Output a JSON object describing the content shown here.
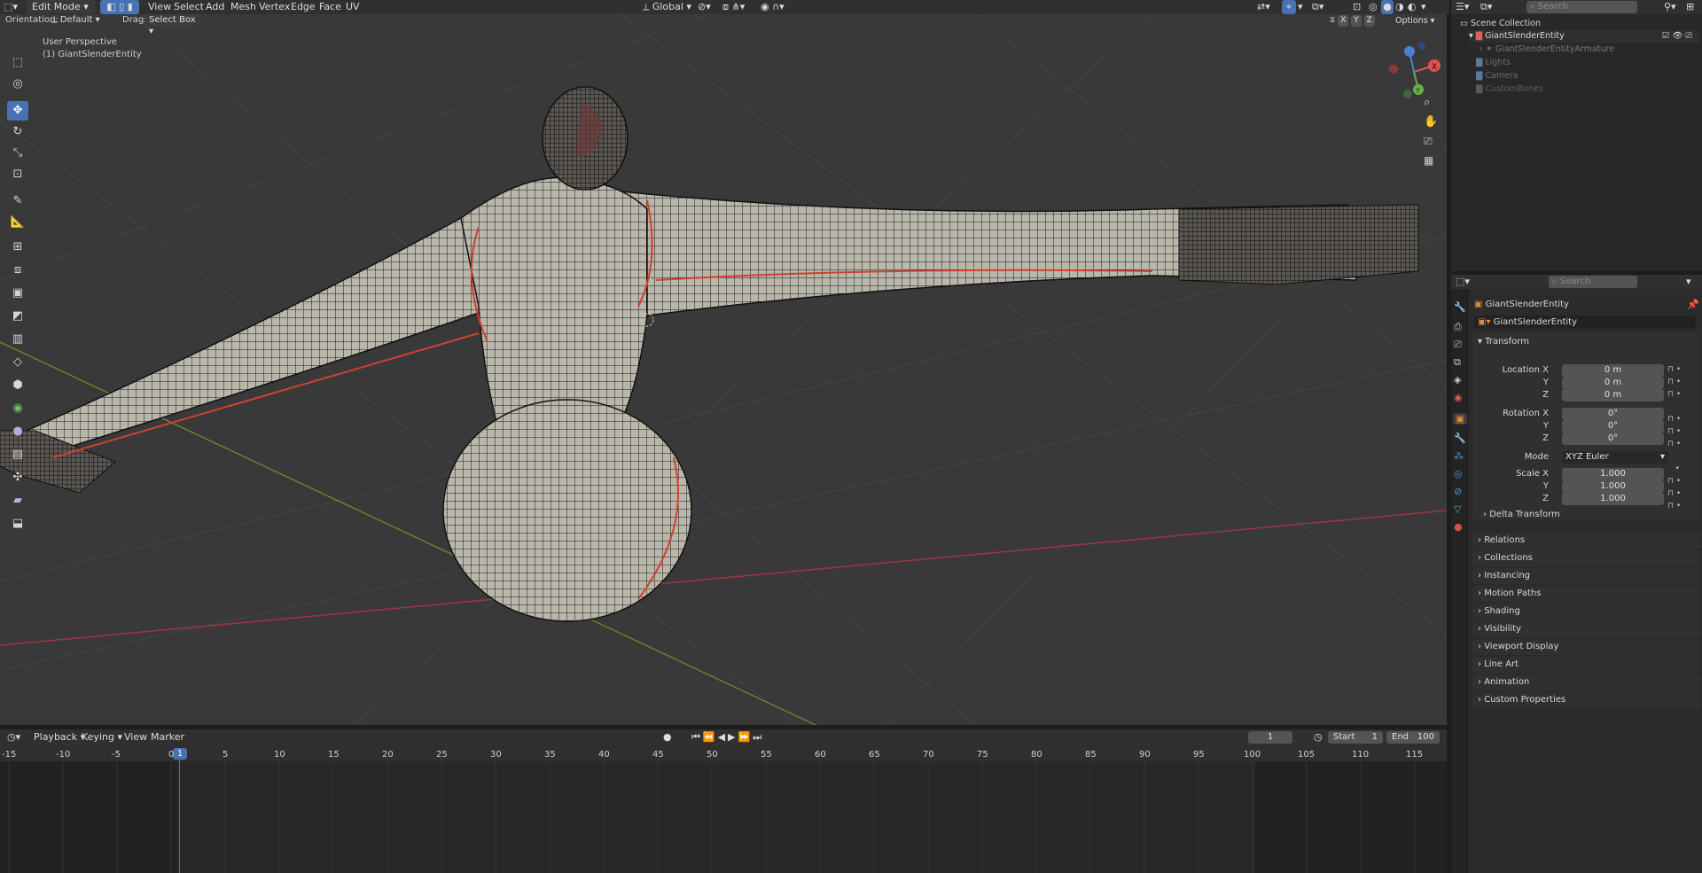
{
  "header": {
    "mode": "Edit Mode",
    "menus": [
      "View",
      "Select",
      "Add",
      "Mesh",
      "Vertex",
      "Edge",
      "Face",
      "UV"
    ],
    "transform_orientation": "Global",
    "search_placeholder": "Search"
  },
  "toolbar_header": {
    "orientation_label": "Orientation:",
    "orientation_value": "Default",
    "drag_label": "Drag:",
    "drag_value": "Select Box",
    "axes": [
      "X",
      "Y",
      "Z"
    ],
    "options": "Options"
  },
  "viewport": {
    "perspective": "User Perspective",
    "object": "(1) GiantSlenderEntity"
  },
  "outliner": {
    "root": "Scene Collection",
    "items": [
      {
        "label": "GiantSlenderEntity",
        "icon": "collection-icon",
        "color": "#e06060"
      },
      {
        "label": "GiantSlenderEntityArmature",
        "icon": "armature-icon",
        "color": "#7a6a5a"
      },
      {
        "label": "Lights",
        "icon": "collection-icon",
        "color": "#5a7a9a"
      },
      {
        "label": "Camera",
        "icon": "collection-icon",
        "color": "#5a7a9a"
      },
      {
        "label": "CustomBones",
        "icon": "collection-icon",
        "color": "#5a5a5a"
      }
    ]
  },
  "properties": {
    "search_placeholder": "Search",
    "object_name": "GiantSlenderEntity",
    "object_field": "GiantSlenderEntity",
    "transform_title": "Transform",
    "location_label": "Location X",
    "rotation_label": "Rotation X",
    "scale_label": "Scale X",
    "y_label": "Y",
    "z_label": "Z",
    "location": [
      "0 m",
      "0 m",
      "0 m"
    ],
    "rotation": [
      "0°",
      "0°",
      "0°"
    ],
    "mode_label": "Mode",
    "mode_value": "XYZ Euler",
    "scale": [
      "1.000",
      "1.000",
      "1.000"
    ],
    "delta": "Delta Transform",
    "sections": [
      "Relations",
      "Collections",
      "Instancing",
      "Motion Paths",
      "Shading",
      "Visibility",
      "Viewport Display",
      "Line Art",
      "Animation",
      "Custom Properties"
    ]
  },
  "timeline": {
    "menus": [
      "Playback",
      "Keying",
      "View",
      "Marker"
    ],
    "current_frame": "1",
    "start_label": "Start",
    "start": "1",
    "end_label": "End",
    "end": "100",
    "ticks": [
      "-15",
      "-10",
      "-5",
      "0",
      "5",
      "10",
      "15",
      "20",
      "25",
      "30",
      "35",
      "40",
      "45",
      "50",
      "55",
      "60",
      "65",
      "70",
      "75",
      "80",
      "85",
      "90",
      "95",
      "100",
      "105",
      "110",
      "115"
    ],
    "playhead": "1"
  },
  "colors": {
    "accent": "#4772b3",
    "seam": "#d04030",
    "x_axis": "#c04050",
    "y_axis": "#8aa030"
  }
}
